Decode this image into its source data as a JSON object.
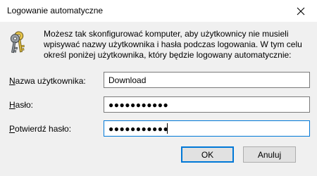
{
  "window": {
    "title": "Logowanie automatyczne"
  },
  "description": "Możesz tak skonfigurować komputer, aby użytkownicy nie musieli wpisywać nazwy użytkownika i hasła podczas logowania. W tym celu określ poniżej użytkownika, który będzie logowany automatycznie:",
  "fields": {
    "username": {
      "label_ul": "N",
      "label_rest": "azwa użytkownika:",
      "value": "Download"
    },
    "password": {
      "label_ul": "H",
      "label_rest": "asło:",
      "masked": "●●●●●●●●●●●"
    },
    "confirm": {
      "label_ul": "P",
      "label_rest": "otwierdź hasło:",
      "masked": "●●●●●●●●●●●"
    }
  },
  "buttons": {
    "ok_label": "OK",
    "cancel_label": "Anuluj"
  },
  "colors": {
    "focus_accent": "#0078d7",
    "window_bg": "#f0f0f0"
  },
  "icons": {
    "dialog": "keys-icon",
    "close": "close-icon"
  }
}
